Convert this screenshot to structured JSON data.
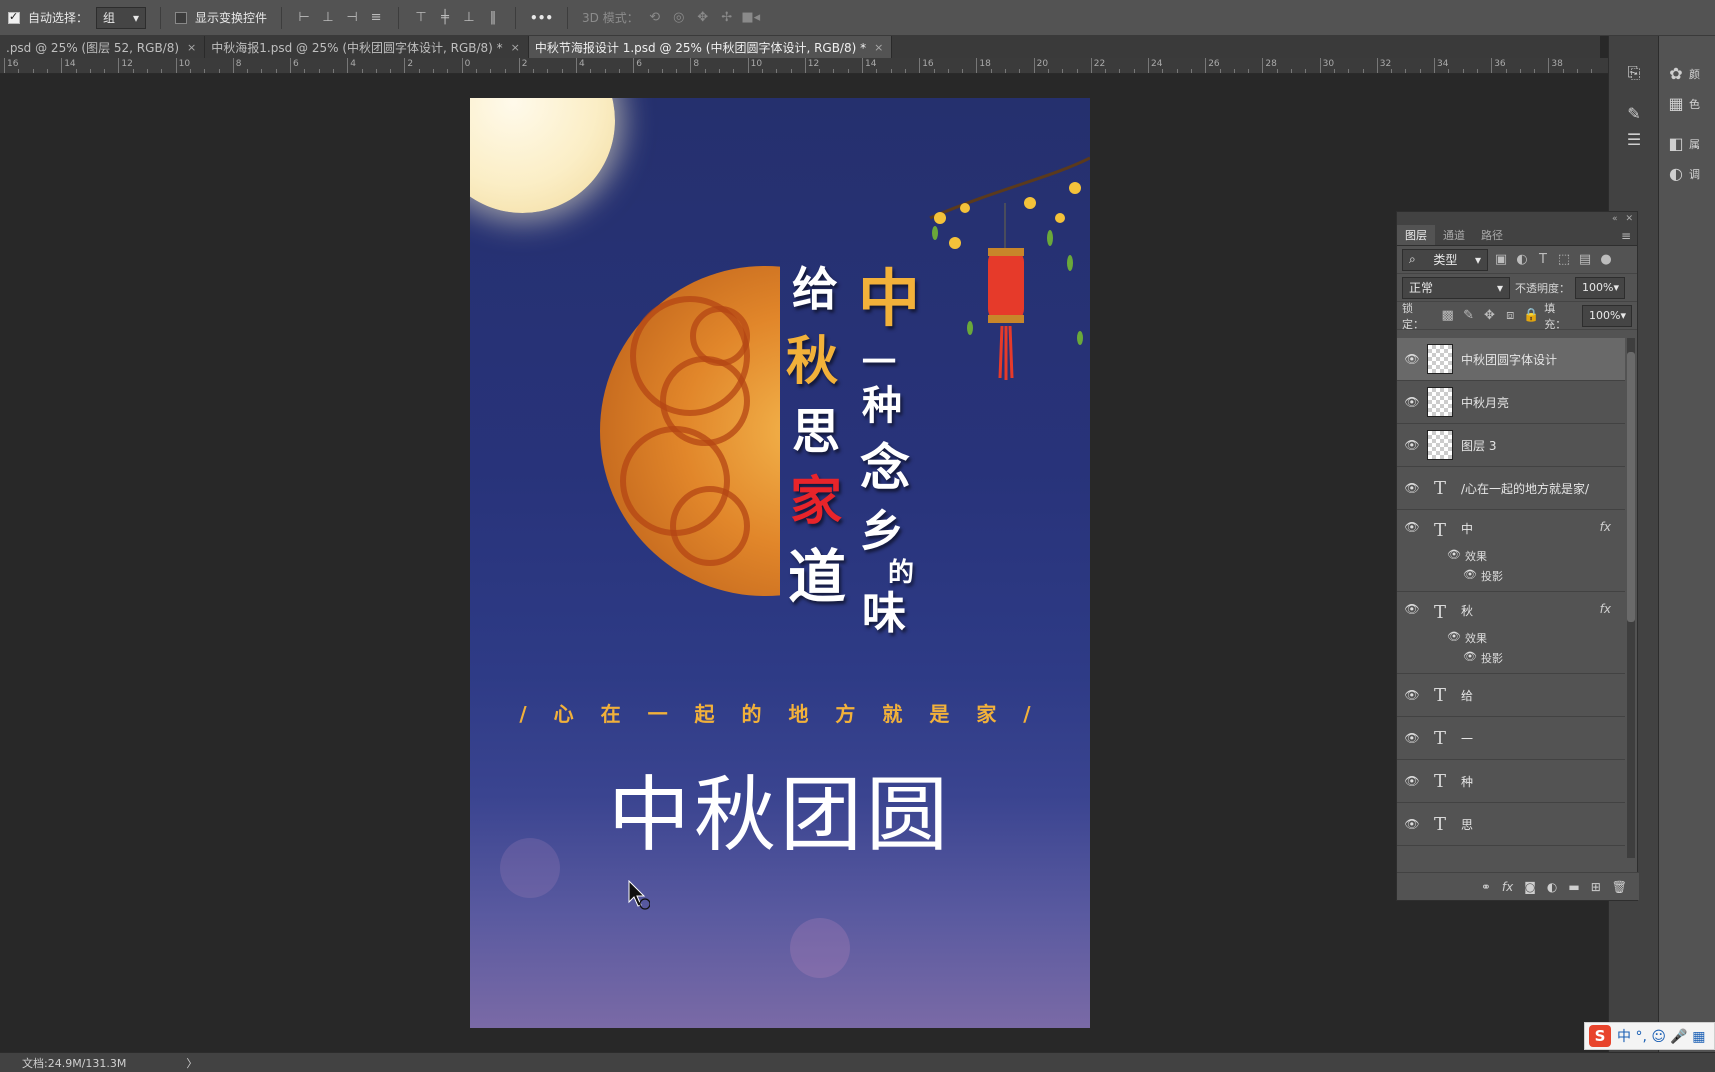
{
  "options_bar": {
    "auto_select_label": "自动选择：",
    "auto_select_value": "组",
    "show_transform_label": "显示变换控件",
    "more_label": "•••",
    "mode_3d_label": "3D 模式："
  },
  "tabs": [
    {
      "label": ".psd @ 25% (图层 52, RGB/8)",
      "close": "×"
    },
    {
      "label": "中秋海报1.psd @ 25% (中秋团圆字体设计, RGB/8) *",
      "close": "×"
    },
    {
      "label": "中秋节海报设计 1.psd @ 25% (中秋团圆字体设计, RGB/8) *",
      "close": "×"
    }
  ],
  "ruler": [
    "16",
    "14",
    "12",
    "10",
    "8",
    "6",
    "4",
    "2",
    "0",
    "2",
    "4",
    "6",
    "8",
    "10",
    "12",
    "14",
    "16",
    "18",
    "20",
    "22",
    "24",
    "26",
    "28",
    "30",
    "32",
    "34",
    "36",
    "38"
  ],
  "poster": {
    "chars_left": [
      "给",
      "秋",
      "思",
      "家",
      "道"
    ],
    "chars_right": [
      "中",
      "一",
      "种",
      "念",
      "乡",
      "的",
      "味"
    ],
    "slogan": "/ 心 在 一 起 的 地 方 就 是 家 /",
    "title": "中秋团圆",
    "colors": {
      "gold": "#f2b13a",
      "red": "#e8242a",
      "sky": "#28337a"
    }
  },
  "right_strip": {
    "icons": [
      "history-icon",
      "brush-icon",
      "adjust-icon"
    ],
    "far_icons": [
      {
        "icon": "palette-icon",
        "label": "颜"
      },
      {
        "icon": "grid-icon",
        "label": "色"
      },
      {
        "icon": "properties-icon",
        "label": "属"
      },
      {
        "icon": "adjustment-icon",
        "label": "调"
      }
    ]
  },
  "layers_panel": {
    "tabs": [
      "图层",
      "通道",
      "路径"
    ],
    "filter_label": "类型",
    "blend_mode": "正常",
    "opacity_label": "不透明度：",
    "opacity_value": "100%",
    "lock_label": "锁定：",
    "fill_label": "填充：",
    "fill_value": "100%",
    "layers": [
      {
        "name": "中秋团圆字体设计",
        "type": "pixel",
        "selected": true
      },
      {
        "name": "中秋月亮",
        "type": "pixel"
      },
      {
        "name": "图层 3",
        "type": "pixel"
      },
      {
        "name": "/心在一起的地方就是家/",
        "type": "text"
      },
      {
        "name": "中",
        "type": "text",
        "fx": true
      },
      {
        "name": "秋",
        "type": "text",
        "fx": true
      },
      {
        "name": "给",
        "type": "text"
      },
      {
        "name": "一",
        "type": "text"
      },
      {
        "name": "种",
        "type": "text"
      },
      {
        "name": "思",
        "type": "text"
      }
    ],
    "effects_label": "效果",
    "shadow_label": "投影",
    "text_glyph": "T",
    "fx_label": "fx"
  },
  "status": {
    "doc_label": "文档:24.9M/131.3M",
    "arrow": "〉"
  },
  "ime": {
    "s": "S",
    "text": "中 °, ☺ 🎤 ▦"
  }
}
